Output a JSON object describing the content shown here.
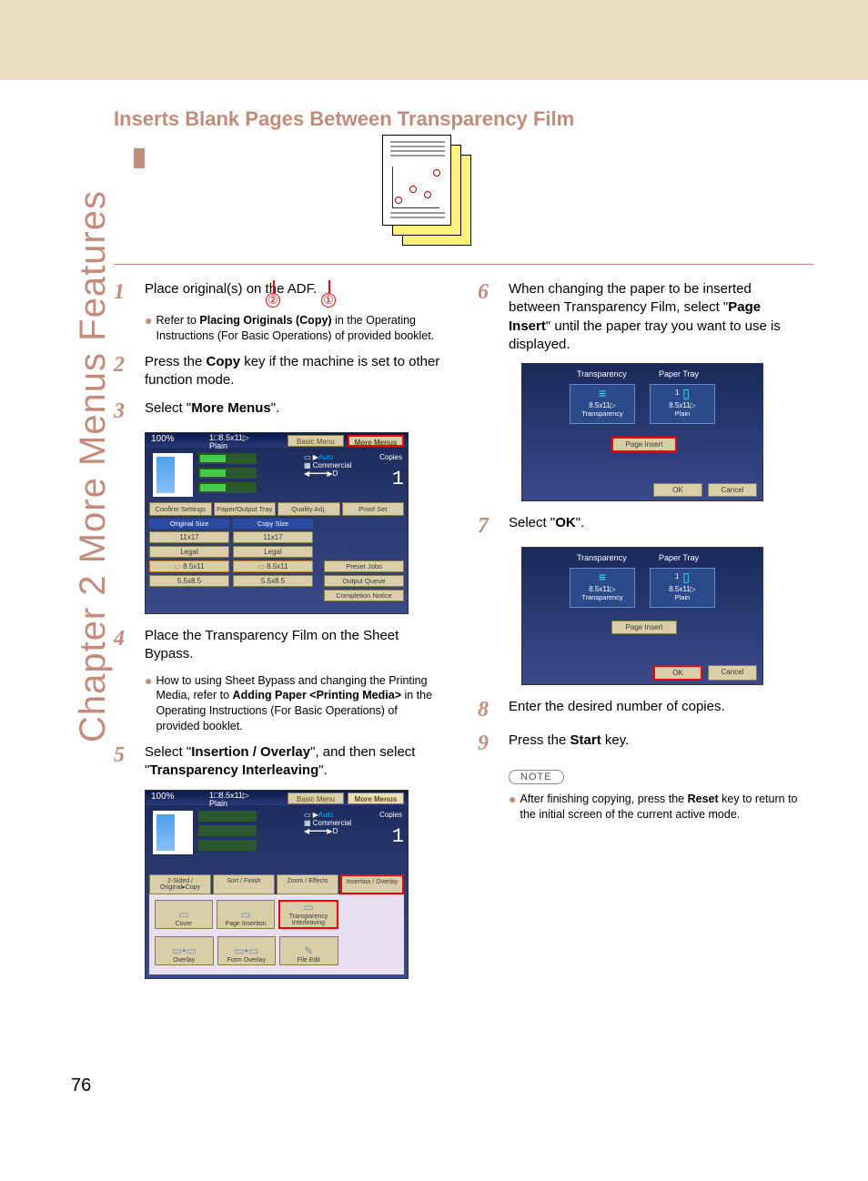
{
  "domain": "Document",
  "page_number": "76",
  "side_tab": "Chapter 2    More Menus Features",
  "heading": "Inserts Blank Pages Between Transparency Film",
  "steps": {
    "s1": {
      "num": "1",
      "text_a": "Place original(s) on the ADF."
    },
    "s1_note": {
      "pre": "Refer to ",
      "b1": "Placing Originals (Copy)",
      "post": " in the Operating Instructions (For Basic Operations) of provided booklet."
    },
    "s2": {
      "num": "2",
      "text_a": "Press the ",
      "b1": "Copy",
      "text_b": " key if the machine is set to other function mode."
    },
    "s3": {
      "num": "3",
      "text_a": "Select \"",
      "b1": "More Menus",
      "text_b": "\"."
    },
    "s4": {
      "num": "4",
      "text_a": "Place the Transparency Film on the Sheet Bypass."
    },
    "s4_note": {
      "pre": "How to using Sheet Bypass and changing the Printing Media, refer to ",
      "b1": "Adding Paper <Printing Media>",
      "post": " in the Operating Instructions (For Basic Operations) of provided booklet."
    },
    "s5": {
      "num": "5",
      "text_a": "Select \"",
      "b1": "Insertion / Overlay",
      "text_b": "\", and then select \"",
      "b2": "Transparency Interleaving",
      "text_c": "\"."
    },
    "s6": {
      "num": "6",
      "text_a": "When changing the paper to be inserted between Transparency Film, select \"",
      "b1": "Page Insert",
      "text_b": "\" until the paper tray you want to use is displayed."
    },
    "s7": {
      "num": "7",
      "text_a": "Select \"",
      "b1": "OK",
      "text_b": "\"."
    },
    "s8": {
      "num": "8",
      "text_a": "Enter the desired number of copies."
    },
    "s9": {
      "num": "9",
      "text_a": "Press the ",
      "b1": "Start",
      "text_b": " key."
    },
    "note_label": "NOTE",
    "final_note": {
      "pre": "After finishing copying, press the ",
      "b1": "Reset",
      "post": " key to return to the initial screen of the current active mode."
    }
  },
  "shot1": {
    "pct": "100%",
    "tray_line1": "1□8.5x11▷",
    "tray_line2": "Plain",
    "tab_basic": "Basic Menu",
    "tab_more": "More Menus",
    "auto_prefix": "▭ ▶",
    "auto": "Auto",
    "copies_label": "Copies",
    "commercial": "▦ Commercial",
    "scale": "◀━━━━▶D",
    "copies": "1",
    "btn_confirm": "Confirm Settings",
    "btn_paper": "Paper/Output Tray",
    "btn_quality": "Quality Adj.",
    "btn_proof": "Proof Set",
    "hdr_orig": "Original Size",
    "hdr_copy": "Copy Size",
    "sizes": [
      "11x17",
      "11x17",
      "Legal",
      "Legal",
      "8.5x11",
      "8.5x11",
      "5.5x8.5",
      "5.5x8.5"
    ],
    "rb_preset": "Preset Jobs",
    "rb_queue": "Output Queue",
    "rb_compl": "Completion Notice"
  },
  "shot2": {
    "pct": "100%",
    "tray_line1": "1□8.5x11▷",
    "tray_line2": "Plain",
    "tab_basic": "Basic Menu",
    "tab_more": "More Menus",
    "auto": "Auto",
    "copies_label": "Copies",
    "commercial": "▦ Commercial",
    "copies": "1",
    "tabs": [
      "2-Sided / Original▸Copy",
      "Sort / Finish",
      "Zoom / Effects",
      "Insertion / Overlay"
    ],
    "row1": [
      "Cover",
      "Page Insertion",
      "Transparency Interleaving"
    ],
    "row2": [
      "Overlay",
      "Form Overlay",
      "File Edit"
    ],
    "callouts": [
      "②",
      "①"
    ]
  },
  "shotS": {
    "hdr1": "Transparency",
    "hdr2": "Paper Tray",
    "c1": {
      "size": "8.5x11▷",
      "type": "Transparency"
    },
    "c2": {
      "num": "1",
      "size": "8.5x11▷",
      "type": "Plain"
    },
    "page_insert": "Page Insert",
    "ok": "OK",
    "cancel": "Cancel"
  }
}
